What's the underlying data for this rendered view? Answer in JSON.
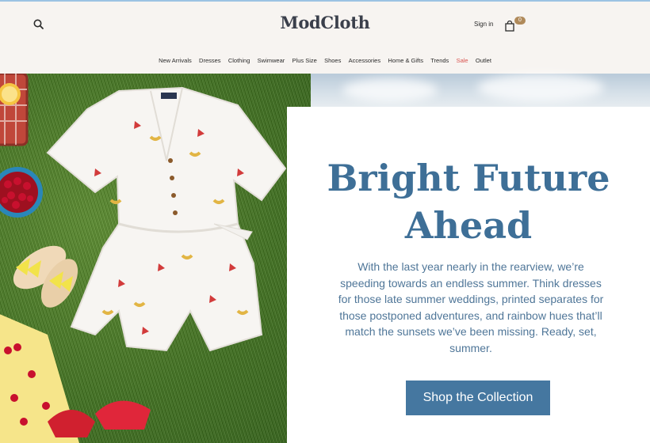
{
  "header": {
    "logo": "ModCloth",
    "signin_label": "Sign in",
    "cart_count": "0",
    "search_icon": "search-icon",
    "cart_icon": "shopping-bag-icon"
  },
  "nav": {
    "items": [
      "New Arrivals",
      "Dresses",
      "Clothing",
      "Swimwear",
      "Plus Size",
      "Shoes",
      "Accessories",
      "Home & Gifts",
      "Trends",
      "Sale",
      "Outlet"
    ]
  },
  "hero": {
    "headline_line1": "Bright Future",
    "headline_line2": "Ahead",
    "body": "With the last year nearly in the rearview, we’re speeding towards an endless summer. Think dresses for those late summer weddings, printed separates for those postponed adventures, and rainbow hues that’ll match the sunsets we’ve been missing. Ready, set, summer.",
    "cta_label": "Shop the Collection"
  },
  "colors": {
    "accent": "#4577a0",
    "headline": "#3e6f97",
    "sale": "#d9534f",
    "badge": "#b08a5a",
    "header_bg": "#f7f4f1",
    "grass": "#3f6f1f"
  }
}
